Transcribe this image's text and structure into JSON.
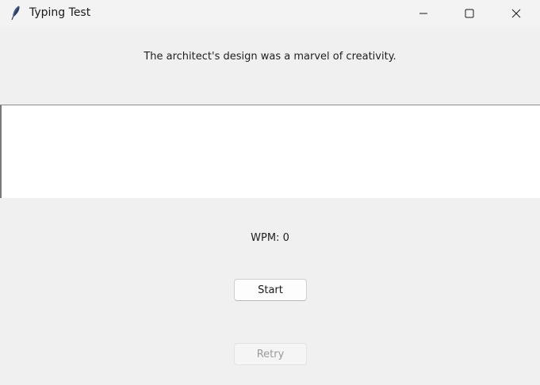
{
  "window": {
    "title": "Typing Test",
    "app_icon": "feather-icon",
    "controls": [
      "minimize-icon",
      "maximize-icon",
      "close-icon"
    ]
  },
  "test": {
    "sentence": "The architect's design was a marvel of creativity.",
    "input_value": "",
    "wpm_label": "WPM: 0"
  },
  "buttons": {
    "start_label": "Start",
    "retry_label": "Retry",
    "retry_disabled": true
  }
}
